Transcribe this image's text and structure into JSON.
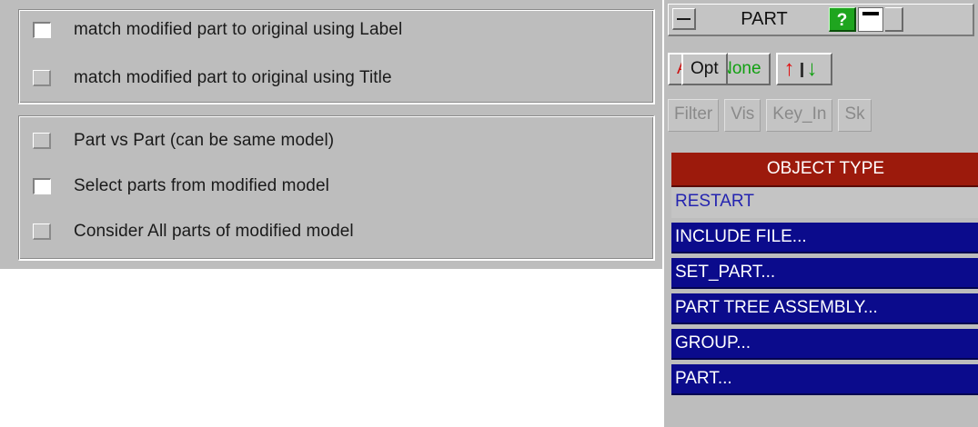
{
  "match_options": {
    "label_option": "match modified part to original using Label",
    "title_option": "match modified part to original using Title",
    "label_checked": true,
    "title_checked": false
  },
  "selection_options": {
    "part_vs_part": "Part vs Part (can be same model)",
    "select_modified": "Select parts from modified model",
    "consider_all": "Consider All parts of modified model"
  },
  "part_panel": {
    "title": "PART",
    "help_label": "?",
    "buttons": {
      "all": "All",
      "none": "None",
      "opt": "Opt",
      "filter": "Filter",
      "vis": "Vis",
      "key_in": "Key_In",
      "sk": "Sk"
    },
    "object_type_header": "OBJECT TYPE",
    "items": [
      "RESTART",
      "INCLUDE FILE...",
      "SET_PART...",
      "PART TREE ASSEMBLY...",
      "GROUP...",
      "PART..."
    ]
  },
  "colors": {
    "panel_bg": "#bdbdbd",
    "header_red": "#9c1a0c",
    "selected_blue": "#0b0b8c",
    "help_green": "#1fa51f",
    "all_red": "#cc1010",
    "none_green": "#11a011"
  },
  "icons": {
    "minimize": "minimize-icon",
    "sort": "sort-up-down-icon",
    "window": "window-bar-icon"
  }
}
